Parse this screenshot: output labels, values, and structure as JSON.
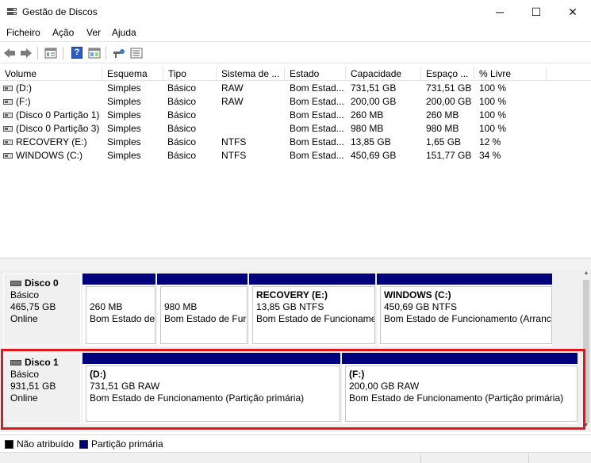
{
  "window": {
    "title": "Gestão de Discos",
    "minimize": "─",
    "maximize": "☐",
    "close": "✕"
  },
  "menu": [
    "Ficheiro",
    "Ação",
    "Ver",
    "Ajuda"
  ],
  "toolbar": {
    "icons": [
      "back-arrow-icon",
      "forward-arrow-icon",
      "properties-icon",
      "help-icon",
      "console-icon",
      "connect-icon",
      "settings-list-icon"
    ],
    "help_glyph": "?"
  },
  "columns": [
    "Volume",
    "Esquema",
    "Tipo",
    "Sistema de ...",
    "Estado",
    "Capacidade",
    "Espaço ...",
    "% Livre"
  ],
  "volumes": [
    {
      "volume": "(D:)",
      "esquema": "Simples",
      "tipo": "Básico",
      "sistema": "RAW",
      "estado": "Bom Estad...",
      "capacidade": "731,51 GB",
      "espaco": "731,51 GB",
      "livre": "100 %"
    },
    {
      "volume": "(F:)",
      "esquema": "Simples",
      "tipo": "Básico",
      "sistema": "RAW",
      "estado": "Bom Estad...",
      "capacidade": "200,00 GB",
      "espaco": "200,00 GB",
      "livre": "100 %"
    },
    {
      "volume": "(Disco 0 Partição 1)",
      "esquema": "Simples",
      "tipo": "Básico",
      "sistema": "",
      "estado": "Bom Estad...",
      "capacidade": "260 MB",
      "espaco": "260 MB",
      "livre": "100 %"
    },
    {
      "volume": "(Disco 0 Partição 3)",
      "esquema": "Simples",
      "tipo": "Básico",
      "sistema": "",
      "estado": "Bom Estad...",
      "capacidade": "980 MB",
      "espaco": "980 MB",
      "livre": "100 %"
    },
    {
      "volume": "RECOVERY (E:)",
      "esquema": "Simples",
      "tipo": "Básico",
      "sistema": "NTFS",
      "estado": "Bom Estad...",
      "capacidade": "13,85 GB",
      "espaco": "1,65 GB",
      "livre": "12 %"
    },
    {
      "volume": "WINDOWS (C:)",
      "esquema": "Simples",
      "tipo": "Básico",
      "sistema": "NTFS",
      "estado": "Bom Estad...",
      "capacidade": "450,69 GB",
      "espaco": "151,77 GB",
      "livre": "34 %"
    }
  ],
  "disks": [
    {
      "name": "Disco 0",
      "type": "Básico",
      "size": "465,75 GB",
      "status": "Online",
      "partitions": [
        {
          "name": "",
          "size": "260 MB",
          "status": "Bom Estado de"
        },
        {
          "name": "",
          "size": "980 MB",
          "status": "Bom Estado de Fur"
        },
        {
          "name": "RECOVERY  (E:)",
          "size": "13,85 GB NTFS",
          "status": "Bom Estado de Funcioname"
        },
        {
          "name": "WINDOWS  (C:)",
          "size": "450,69 GB NTFS",
          "status": "Bom Estado de Funcionamento (Arranc"
        }
      ]
    },
    {
      "name": "Disco 1",
      "type": "Básico",
      "size": "931,51 GB",
      "status": "Online",
      "partitions": [
        {
          "name": "(D:)",
          "size": "731,51 GB RAW",
          "status": "Bom Estado de Funcionamento (Partição primária)"
        },
        {
          "name": "(F:)",
          "size": "200,00 GB RAW",
          "status": "Bom Estado de Funcionamento (Partição primária)"
        }
      ]
    }
  ],
  "legend": [
    {
      "label": "Não atribuído",
      "color": "#000000"
    },
    {
      "label": "Partição primária",
      "color": "#00007d"
    }
  ],
  "colors": {
    "partition_bar": "#00007d",
    "highlight": "#e0161c"
  }
}
